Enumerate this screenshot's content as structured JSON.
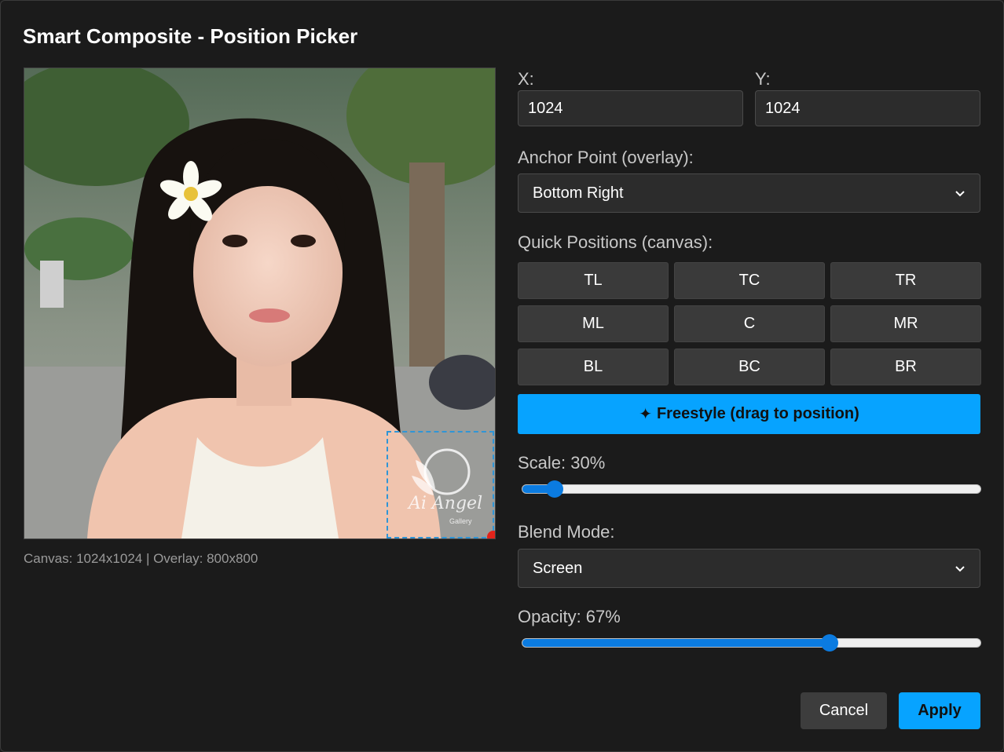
{
  "dialog": {
    "title": "Smart Composite - Position Picker"
  },
  "preview": {
    "info": "Canvas: 1024x1024 | Overlay: 800x800",
    "overlay_text": "Ai Angel",
    "overlay_subtext": "Gallery"
  },
  "position": {
    "x_label": "X:",
    "x_value": "1024",
    "y_label": "Y:",
    "y_value": "1024"
  },
  "anchor": {
    "label": "Anchor Point (overlay):",
    "value": "Bottom Right"
  },
  "quick": {
    "label": "Quick Positions (canvas):",
    "buttons": [
      "TL",
      "TC",
      "TR",
      "ML",
      "C",
      "MR",
      "BL",
      "BC",
      "BR"
    ]
  },
  "freestyle": {
    "icon": "sparkle-icon",
    "glyph": "✦",
    "label": "Freestyle (drag to position)"
  },
  "scale": {
    "label": "Scale: 30%",
    "value": 0.07
  },
  "blend": {
    "label": "Blend Mode:",
    "value": "Screen"
  },
  "opacity": {
    "label": "Opacity: 67%",
    "value": 0.67
  },
  "actions": {
    "cancel": "Cancel",
    "apply": "Apply"
  },
  "colors": {
    "accent": "#07a3ff",
    "slider": "#0b7be0",
    "background": "#1b1b1b"
  }
}
